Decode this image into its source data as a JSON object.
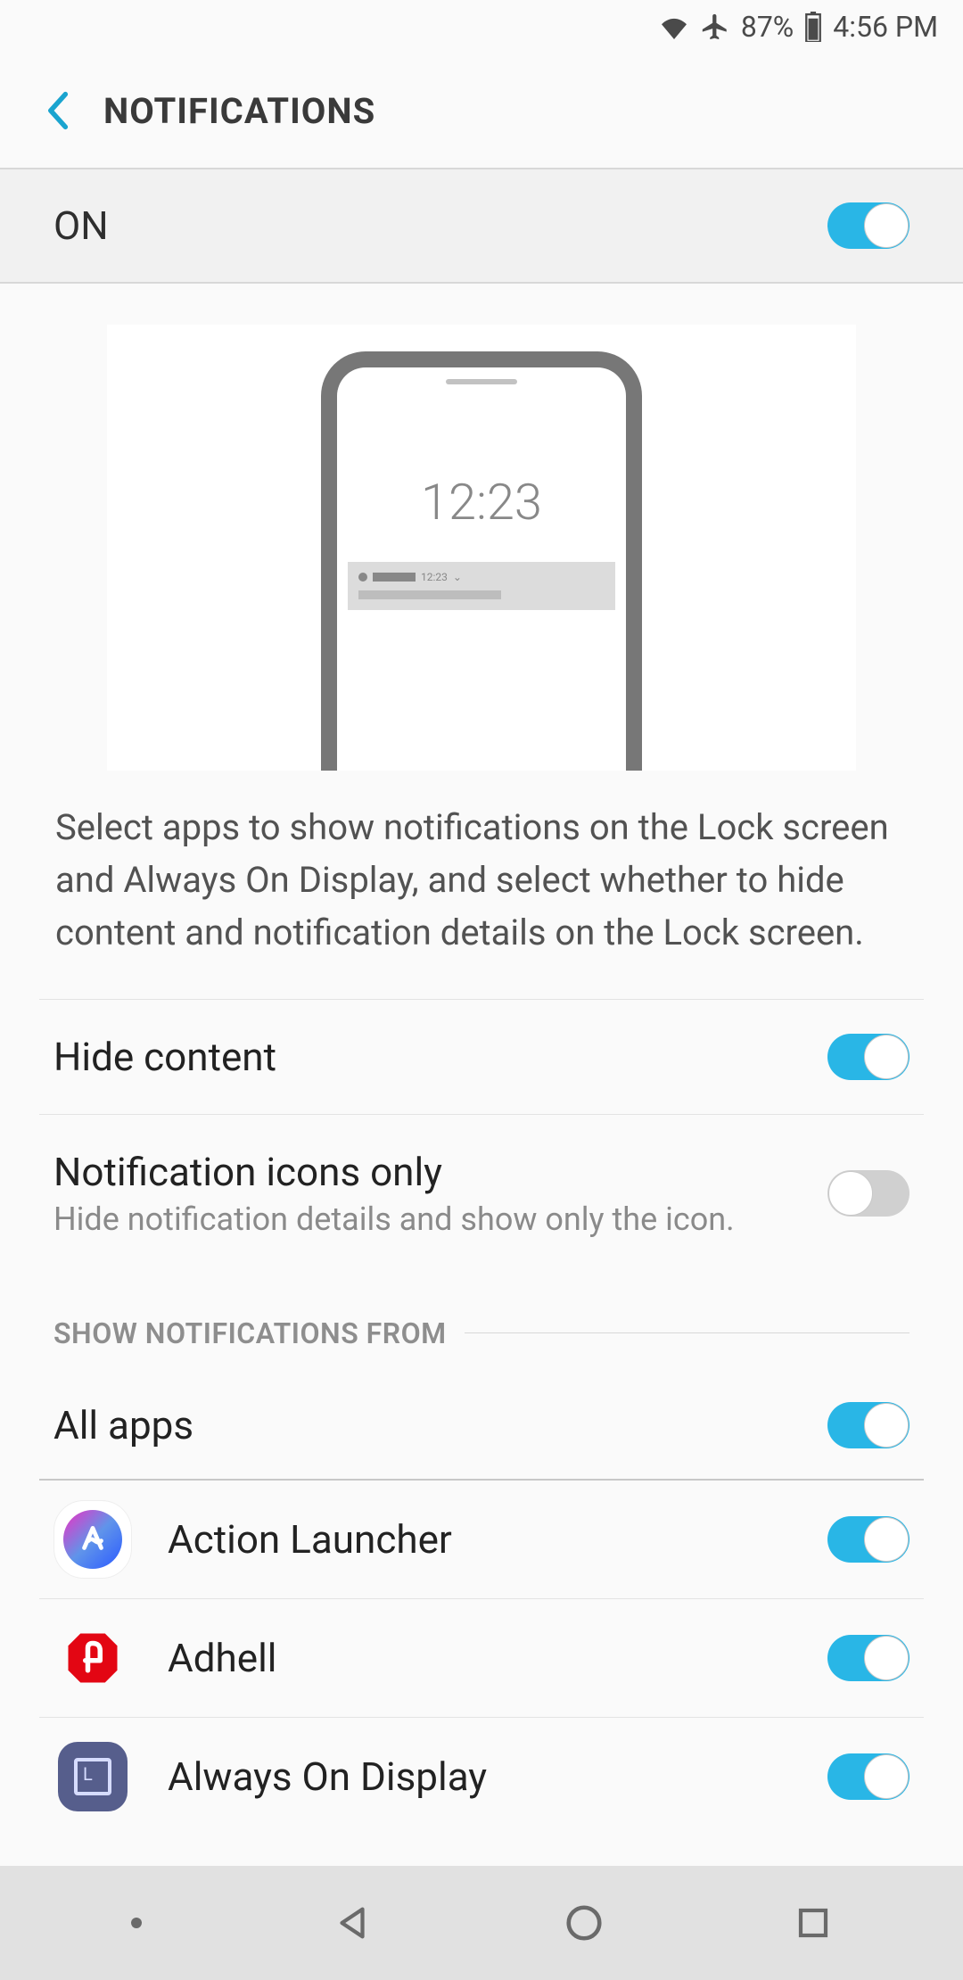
{
  "status_bar": {
    "battery_pct": "87%",
    "time": "4:56 PM"
  },
  "header": {
    "title": "NOTIFICATIONS"
  },
  "master_toggle": {
    "label": "ON",
    "on": true
  },
  "preview": {
    "clock": "12:23",
    "notif_time": "12:23"
  },
  "description": "Select apps to show notifications on the Lock screen and Always On Display, and select whether to hide content and notification details on the Lock screen.",
  "settings": [
    {
      "key": "hide_content",
      "title": "Hide content",
      "subtitle": "",
      "on": true
    },
    {
      "key": "icons_only",
      "title": "Notification icons only",
      "subtitle": "Hide notification details and show only the icon.",
      "on": false
    }
  ],
  "section_header": "SHOW NOTIFICATIONS FROM",
  "all_apps": {
    "title": "All apps",
    "on": true
  },
  "apps": [
    {
      "key": "action_launcher",
      "name": "Action Launcher",
      "on": true
    },
    {
      "key": "adhell",
      "name": "Adhell",
      "on": true
    },
    {
      "key": "aod",
      "name": "Always On Display",
      "on": true
    }
  ]
}
